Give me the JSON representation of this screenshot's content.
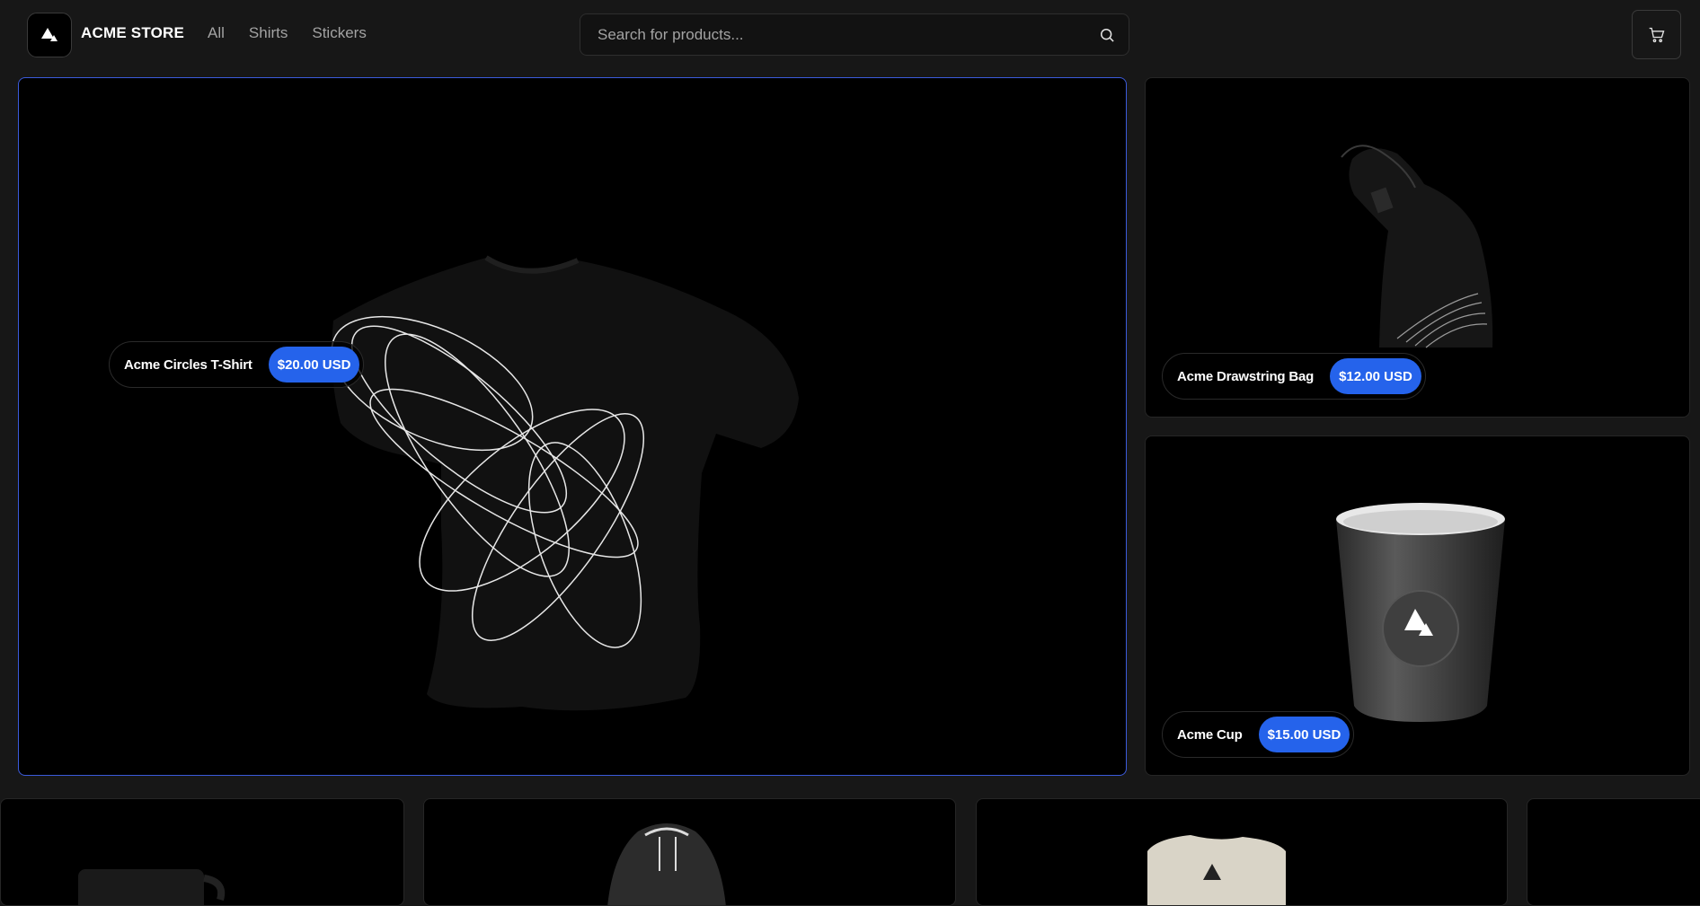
{
  "nav": {
    "store_name": "ACME STORE",
    "links": [
      {
        "label": "All"
      },
      {
        "label": "Shirts"
      },
      {
        "label": "Stickers"
      }
    ],
    "search_placeholder": "Search for products...",
    "icons": {
      "logo": "acme-triangle-logo",
      "search": "search-icon",
      "cart": "cart-icon"
    }
  },
  "featured": {
    "main": {
      "name": "Acme Circles T-Shirt",
      "price": "$20.00 USD"
    },
    "bag": {
      "name": "Acme Drawstring Bag",
      "price": "$12.00 USD"
    },
    "cup": {
      "name": "Acme Cup",
      "price": "$15.00 USD"
    }
  },
  "colors": {
    "accent": "#2563eb",
    "background": "#171717",
    "tile": "#000000",
    "active_border": "#3b5bdb"
  }
}
